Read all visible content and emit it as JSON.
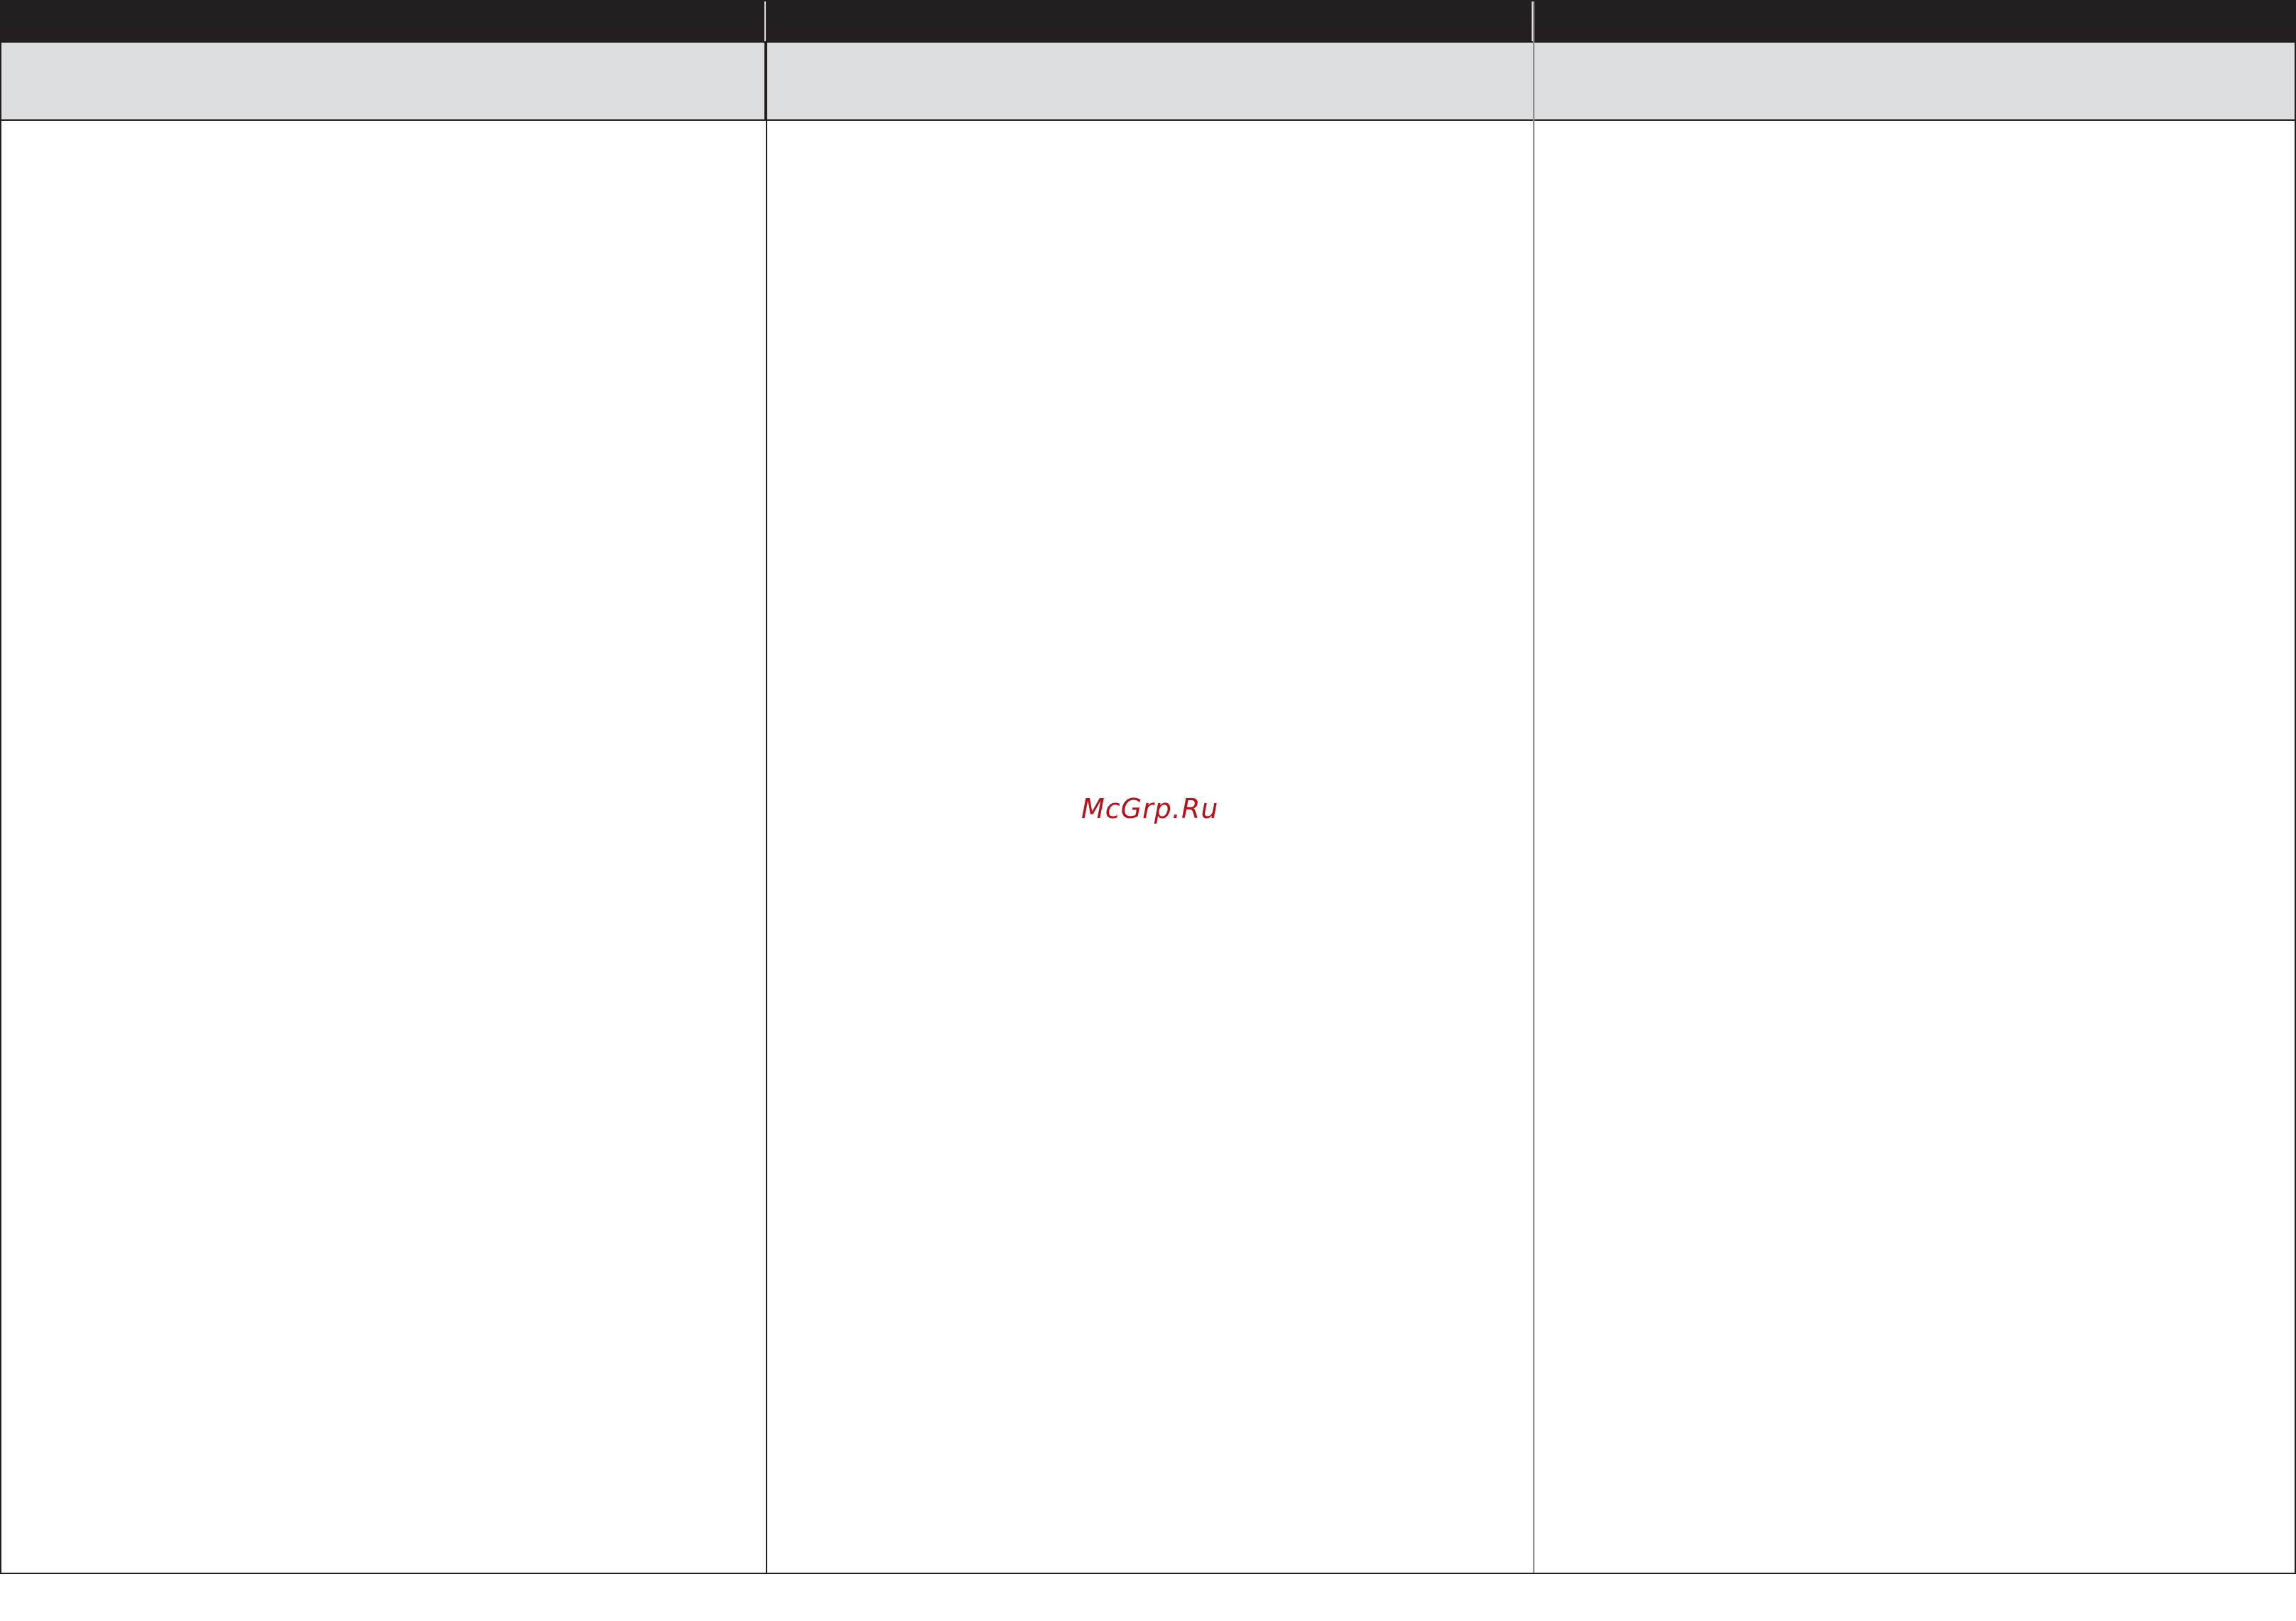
{
  "watermark": {
    "text": "McGrp.Ru",
    "color": "#b5121b"
  },
  "colors": {
    "header_bar": "#231f20",
    "subheader": "#dcdddf",
    "border": "#231f20"
  },
  "columns": [
    {
      "header": "",
      "subheader": "",
      "body": ""
    },
    {
      "header": "",
      "subheader": "",
      "body": ""
    },
    {
      "header": "",
      "subheader": "",
      "body": ""
    }
  ]
}
